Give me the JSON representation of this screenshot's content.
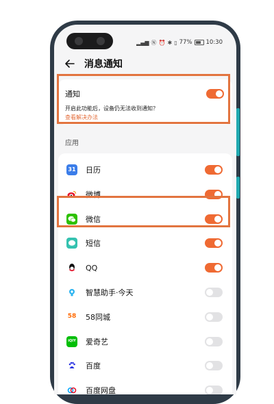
{
  "status_bar": {
    "battery": "77%",
    "time": "10:30"
  },
  "header": {
    "title": "消息通知"
  },
  "notification": {
    "label": "通知",
    "enabled": true,
    "description": "开启此功能后，设备仍无法收到通知？",
    "help_link": "查看解决办法"
  },
  "section": {
    "label": "应用"
  },
  "apps": [
    {
      "name": "日历",
      "enabled": true,
      "icon": "calendar-icon",
      "icon_text": "31",
      "color": "#3b7de9"
    },
    {
      "name": "微博",
      "enabled": true,
      "icon": "weibo-icon",
      "color": "#e6162d"
    },
    {
      "name": "微信",
      "enabled": true,
      "icon": "wechat-icon",
      "color": "#2dc100"
    },
    {
      "name": "短信",
      "enabled": true,
      "icon": "messages-icon",
      "color": "#35c2b0"
    },
    {
      "name": "QQ",
      "enabled": true,
      "icon": "qq-icon",
      "color": "#111111"
    },
    {
      "name": "智慧助手·今天",
      "enabled": false,
      "icon": "assistant-icon",
      "color": "#2bb3f0"
    },
    {
      "name": "58同城",
      "enabled": false,
      "icon": "58-icon",
      "icon_text": "58",
      "color": "#ff6a00"
    },
    {
      "name": "爱奇艺",
      "enabled": false,
      "icon": "iqiyi-icon",
      "icon_text": "iQIY",
      "color": "#00be06"
    },
    {
      "name": "百度",
      "enabled": false,
      "icon": "baidu-icon",
      "color": "#2932e1"
    },
    {
      "name": "百度网盘",
      "enabled": false,
      "icon": "baidu-netdisk-icon",
      "color": "#06a7ff"
    }
  ],
  "colors": {
    "accent": "#ef6a33",
    "highlight": "#e2743f",
    "toggle_off": "#e2e2e4"
  }
}
